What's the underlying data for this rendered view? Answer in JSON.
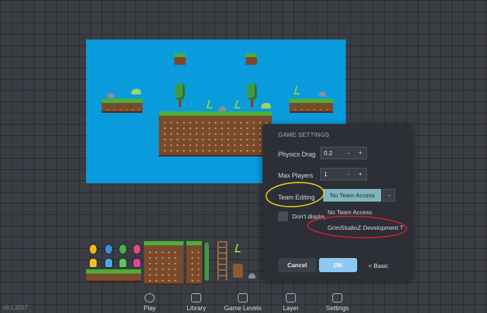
{
  "settings": {
    "title": "GAME SETTINGS",
    "physics_drag": {
      "label": "Physics Drag",
      "value": "0.2",
      "minus": "-",
      "plus": "+"
    },
    "max_players": {
      "label": "Max Players",
      "value": "1",
      "minus": "-",
      "plus": "+"
    },
    "team_editing": {
      "label": "Team Editing",
      "selected": "No Team Access",
      "caret": "-"
    },
    "team_options": [
      "No Team Access",
      "GrimStudioZ Development T"
    ],
    "dont_display_label": "Don't display",
    "cancel_label": "Cancel",
    "ok_label": "OK",
    "basic_label": "< Basic"
  },
  "nav": {
    "items": [
      {
        "label": "Play",
        "icon": "play-icon"
      },
      {
        "label": "Library",
        "icon": "cube-icon"
      },
      {
        "label": "Game Levels",
        "icon": "image-icon"
      },
      {
        "label": "Layer",
        "icon": "layers-icon"
      },
      {
        "label": "Settings",
        "icon": "sliders-icon"
      }
    ]
  },
  "version": "v0.1.2517",
  "colors": {
    "sky": "#0a9bdc",
    "panel": "#2c2f36",
    "ok_button": "#8fc8f2",
    "selected_option": "#7fb6bd",
    "annotation_yellow": "#f2d21b",
    "annotation_red": "#d81f2a"
  }
}
